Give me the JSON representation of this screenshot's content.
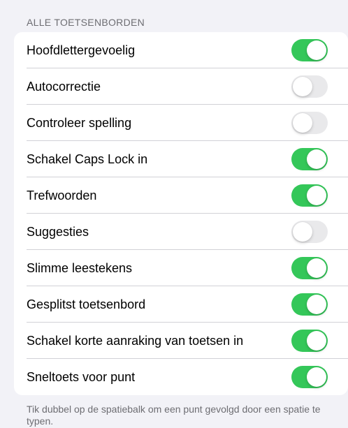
{
  "section": {
    "header": "ALLE TOETSENBORDEN",
    "footer": "Tik dubbel op de spatiebalk om een punt gevolgd door een spatie te typen."
  },
  "colors": {
    "toggle_on": "#34c759",
    "toggle_off": "#e9e9eb",
    "background": "#f2f2f7"
  },
  "settings": [
    {
      "label": "Hoofdlettergevoelig",
      "on": true
    },
    {
      "label": "Autocorrectie",
      "on": false
    },
    {
      "label": "Controleer spelling",
      "on": false
    },
    {
      "label": "Schakel Caps Lock in",
      "on": true
    },
    {
      "label": "Trefwoorden",
      "on": true
    },
    {
      "label": "Suggesties",
      "on": false
    },
    {
      "label": "Slimme leestekens",
      "on": true
    },
    {
      "label": "Gesplitst toetsenbord",
      "on": true
    },
    {
      "label": "Schakel korte aanraking van toetsen in",
      "on": true
    },
    {
      "label": "Sneltoets voor punt",
      "on": true
    }
  ]
}
